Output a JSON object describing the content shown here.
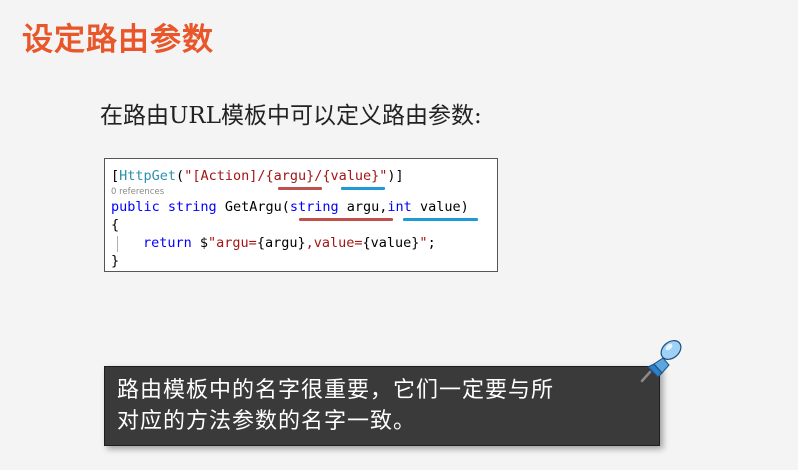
{
  "slide": {
    "title": "设定路由参数",
    "subtitle": "在路由URL模板中可以定义路由参数:"
  },
  "code": {
    "line1": {
      "bracket_open": "[",
      "attr": "HttpGet",
      "paren_open": "(",
      "string": "\"[Action]/{argu}/{value}\"",
      "paren_close": ")]"
    },
    "references": "0 references",
    "line2": {
      "public_kw": "public",
      "string_kw": "string",
      "method": " GetArgu(",
      "param1_type": "string",
      "param1_name": " argu,",
      "param2_type": "int",
      "param2_name": " value)"
    },
    "brace_open": "{",
    "line4": {
      "return_kw": "return",
      "dollar": " $",
      "str1": "\"argu=",
      "interp1": "{argu}",
      "str2": ",value=",
      "interp2": "{value}",
      "str3": "\"",
      "semicolon": ";"
    },
    "brace_close": "}"
  },
  "note": {
    "line1": "路由模板中的名字很重要，它们一定要与所",
    "line2": "对应的方法参数的名字一致。"
  },
  "colors": {
    "title": "#e8562a",
    "keyword": "#0000ff",
    "type": "#2b91af",
    "string": "#a31515",
    "underline_red": "#c0504d",
    "underline_blue": "#1f9ad6",
    "note_bg": "#3a3a3a"
  },
  "icons": {
    "pin": "pushpin-icon"
  }
}
